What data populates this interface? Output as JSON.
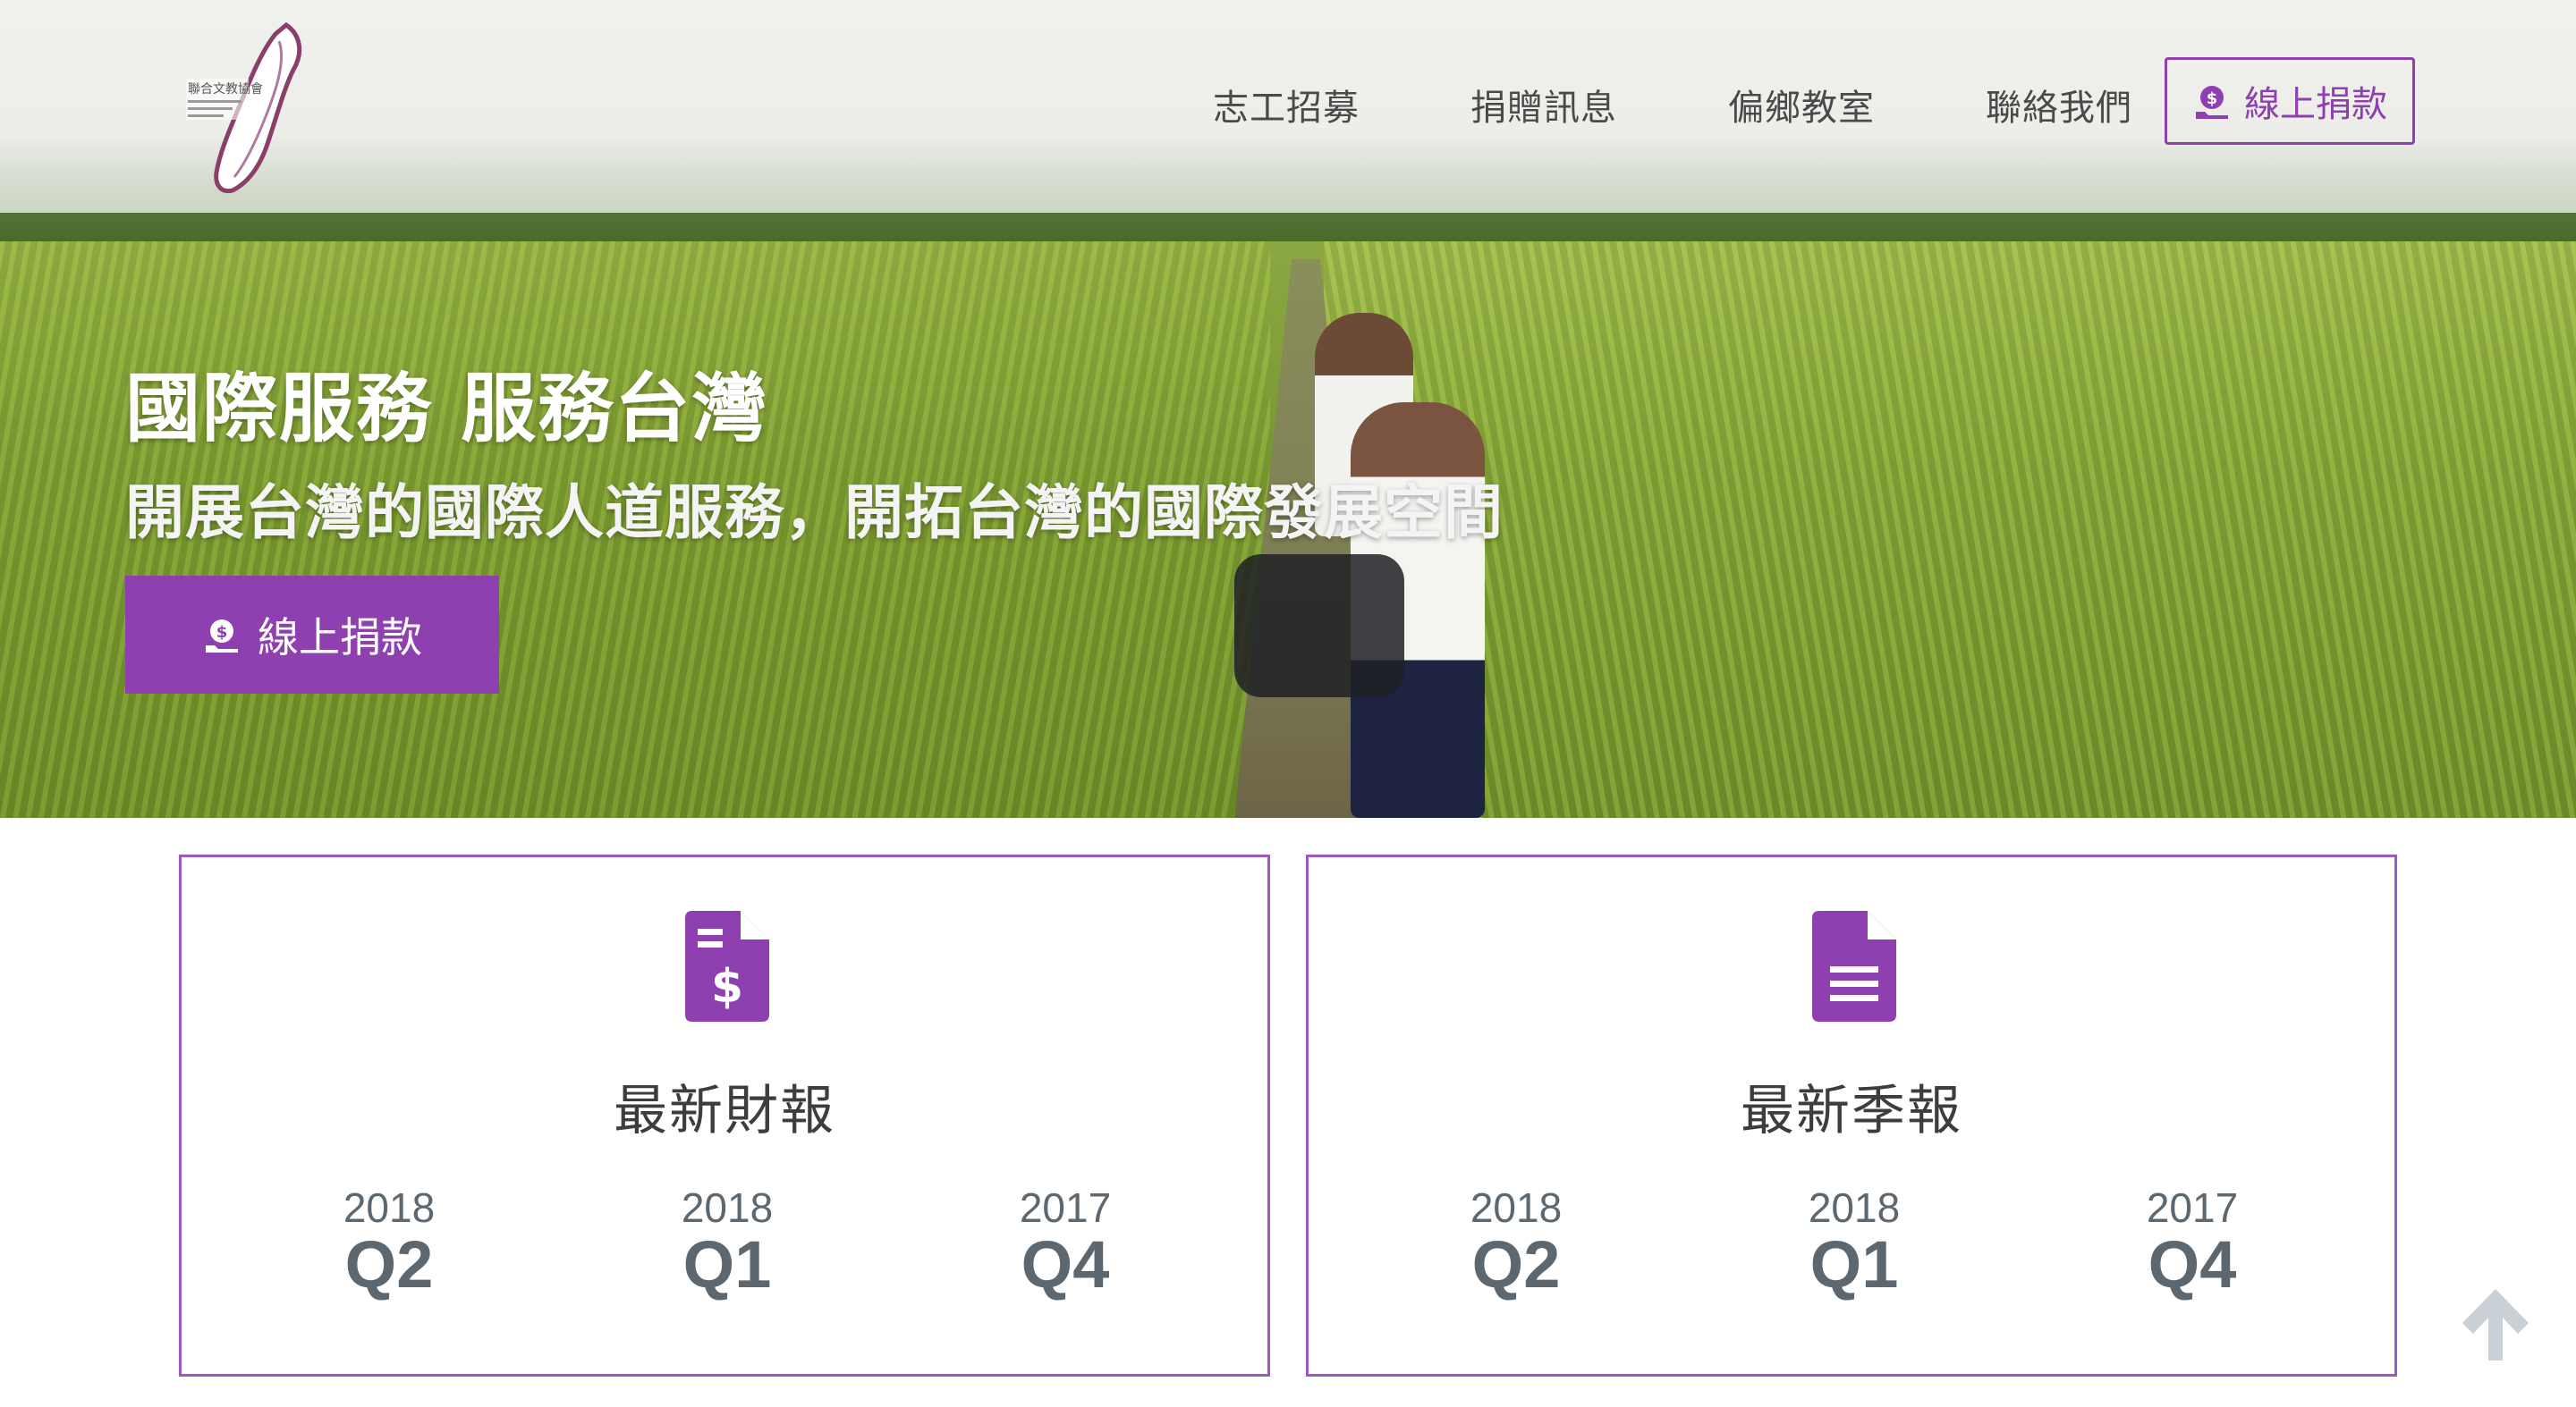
{
  "header": {
    "logo_text": "聯合文教協會",
    "nav": [
      {
        "label": "志工招募"
      },
      {
        "label": "捐贈訊息"
      },
      {
        "label": "偏鄉教室"
      },
      {
        "label": "聯絡我們"
      }
    ],
    "donate_label": "線上捐款"
  },
  "hero": {
    "title": "國際服務 服務台灣",
    "subtitle": "開展台灣的國際人道服務，開拓台灣的國際發展空間",
    "button_label": "線上捐款"
  },
  "cards": [
    {
      "title": "最新財報",
      "icon": "invoice-dollar-icon",
      "reports": [
        {
          "year": "2018",
          "quarter": "Q2"
        },
        {
          "year": "2018",
          "quarter": "Q1"
        },
        {
          "year": "2017",
          "quarter": "Q4"
        }
      ]
    },
    {
      "title": "最新季報",
      "icon": "document-text-icon",
      "reports": [
        {
          "year": "2018",
          "quarter": "Q2"
        },
        {
          "year": "2018",
          "quarter": "Q1"
        },
        {
          "year": "2017",
          "quarter": "Q4"
        }
      ]
    }
  ],
  "colors": {
    "accent": "#8e3fb0",
    "card_border": "#9b59c1",
    "report_text": "#5c6770",
    "scroll_arrow": "#c9d0d6"
  }
}
